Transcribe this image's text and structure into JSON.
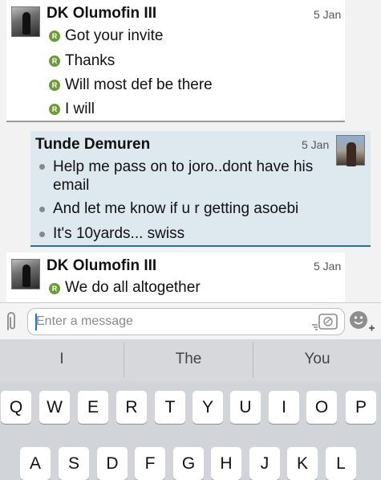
{
  "messages": [
    {
      "sender": "DK Olumofin III",
      "date": "5 Jan",
      "lines": [
        "Got your invite",
        "Thanks",
        "Will most def be there",
        "I will"
      ]
    },
    {
      "sender": "Tunde Demuren",
      "date": "5 Jan",
      "lines": [
        "Help me pass on to joro..dont have his email",
        "And let me know if u r getting asoebi",
        "It's 10yards... swiss"
      ]
    },
    {
      "sender": "DK Olumofin III",
      "date": "5 Jan",
      "lines": [
        "We do all altogether"
      ]
    }
  ],
  "read_badge": "R",
  "composer": {
    "placeholder": "Enter a message"
  },
  "keyboard": {
    "suggestions": [
      "I",
      "The",
      "You"
    ],
    "row1": [
      "Q",
      "W",
      "E",
      "R",
      "T",
      "Y",
      "U",
      "I",
      "O",
      "P"
    ],
    "row2": [
      "A",
      "S",
      "D",
      "F",
      "G",
      "H",
      "J",
      "K",
      "L"
    ]
  },
  "colors": {
    "accent": "#2c6c9c",
    "read_badge": "#6e9a3a",
    "highlight_bubble": "#dde8ef"
  }
}
